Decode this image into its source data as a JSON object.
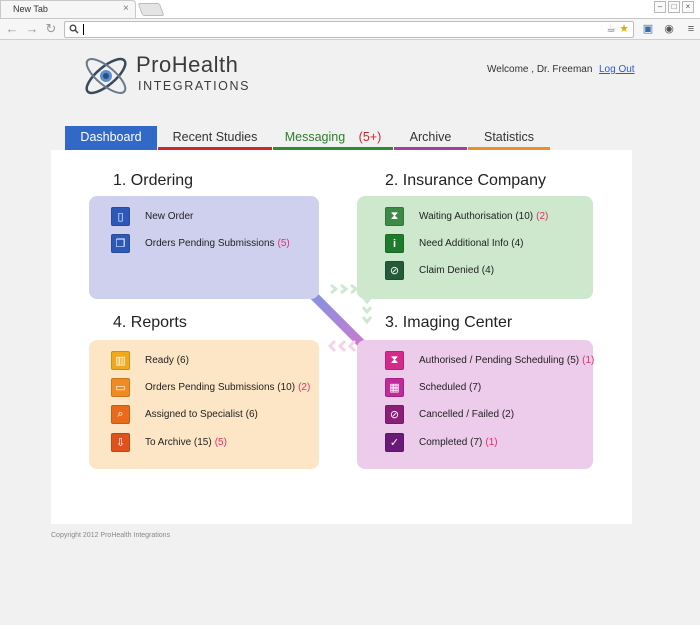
{
  "browser": {
    "tab_title": "New Tab",
    "tab_close": "×",
    "controls": [
      "–",
      "□",
      "×"
    ],
    "address_value": ""
  },
  "brand": {
    "main": "ProHealth",
    "sub": "INTEGRATIONS"
  },
  "header": {
    "welcome": "Welcome , Dr. Freeman",
    "logout": "Log Out"
  },
  "nav": {
    "tabs": [
      {
        "label": "Dashboard",
        "color": "#3269c8",
        "active": true
      },
      {
        "label": "Recent Studies",
        "color": "#d0262e"
      },
      {
        "label": "Messaging",
        "count": "(5+)",
        "color": "#2e8b2e"
      },
      {
        "label": "Archive",
        "color": "#a23ea6"
      },
      {
        "label": "Statistics",
        "color": "#f08c2a"
      }
    ]
  },
  "sections": {
    "ordering": {
      "title": "1. Ordering",
      "color": "#cfcfee",
      "items": [
        {
          "label": "New Order",
          "icon": "document-icon"
        },
        {
          "label": "Orders Pending Submissions",
          "badge": "(5)",
          "icon": "documents-icon"
        }
      ]
    },
    "insurance": {
      "title": "2. Insurance Company",
      "color": "#cde8cd",
      "items": [
        {
          "label": "Waiting Authorisation (10)",
          "badge": "(2)",
          "icon": "hourglass-icon"
        },
        {
          "label": "Need Additional Info (4)",
          "icon": "info-icon"
        },
        {
          "label": "Claim Denied (4)",
          "icon": "denied-icon"
        }
      ]
    },
    "reports": {
      "title": "4. Reports",
      "color": "#fde6c6",
      "items": [
        {
          "label": "Ready (6)",
          "icon": "book-icon"
        },
        {
          "label": "Orders Pending Submissions (10)",
          "badge": "(2)",
          "icon": "folder-icon"
        },
        {
          "label": "Assigned to Specialist (6)",
          "icon": "search-icon"
        },
        {
          "label": "To Archive (15)",
          "badge": "(5)",
          "icon": "archive-icon"
        }
      ]
    },
    "imaging": {
      "title": "3. Imaging Center",
      "color": "#eccbeb",
      "items": [
        {
          "label": "Authorised / Pending Scheduling (5)",
          "badge": "(1)",
          "icon": "hourglass-icon"
        },
        {
          "label": "Scheduled (7)",
          "icon": "calendar-icon"
        },
        {
          "label": "Cancelled / Failed (2)",
          "icon": "cancel-icon"
        },
        {
          "label": "Completed (7)",
          "badge": "(1)",
          "icon": "check-icon"
        }
      ]
    }
  },
  "footer": {
    "copyright": "Copyright 2012 ProHealth Integrations"
  }
}
